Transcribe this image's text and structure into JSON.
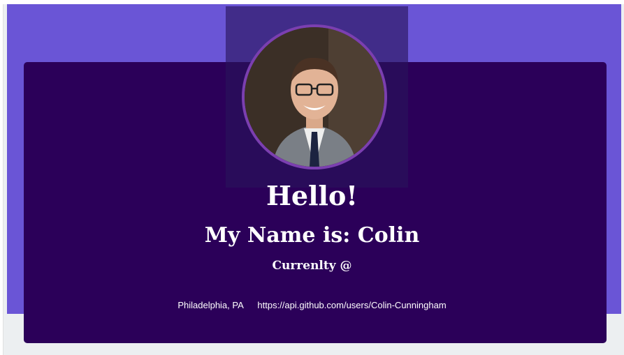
{
  "profile": {
    "greeting": "Hello!",
    "name_line": "My Name is: Colin",
    "current_line": "Currenlty @",
    "location": "Philadelphia, PA",
    "url": "https://api.github.com/users/Colin-Cunningham"
  },
  "colors": {
    "banner": "#6a55d6",
    "card": "#2b0059",
    "avatar_border": "#7b3fb0"
  }
}
